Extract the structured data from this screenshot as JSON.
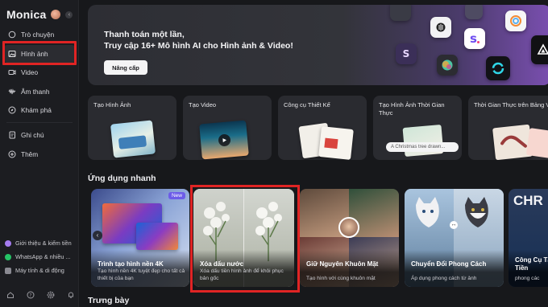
{
  "app": {
    "name": "Monica"
  },
  "sidebar": {
    "items": [
      {
        "label": "Trò chuyện",
        "icon": "chat-icon"
      },
      {
        "label": "Hình ảnh",
        "icon": "image-icon",
        "active": true
      },
      {
        "label": "Video",
        "icon": "video-icon"
      },
      {
        "label": "Âm thanh",
        "icon": "audio-icon"
      },
      {
        "label": "Khám phá",
        "icon": "compass-icon"
      }
    ],
    "items2": [
      {
        "label": "Ghi chú",
        "icon": "note-icon"
      },
      {
        "label": "Thêm",
        "icon": "plus-circle-icon"
      }
    ],
    "bottom": [
      {
        "label": "Giới thiệu & kiếm tiền",
        "color": "#a57cf0"
      },
      {
        "label": "WhatsApp & nhiều ...",
        "color": "#25c366"
      },
      {
        "label": "Máy tính & di động",
        "color": "#8a8a92"
      }
    ]
  },
  "hero": {
    "line1": "Thanh toán một lần,",
    "line2": "Truy cập 16+ Mô hình AI cho Hình ảnh & Video!",
    "button": "Nâng cấp"
  },
  "categories": [
    {
      "label": "Tạo Hình Ảnh"
    },
    {
      "label": "Tạo Video"
    },
    {
      "label": "Công cụ Thiết Kế"
    },
    {
      "label": "Tạo Hình Ảnh Thời Gian Thực",
      "input_placeholder": "A Christmas tree drawn..."
    },
    {
      "label": "Thời Gian Thực trên Bảng Vẽ"
    }
  ],
  "quick_apps_title": "Ứng dụng nhanh",
  "quick_apps": [
    {
      "name": "Trình tạo hình nền 4K",
      "desc": "Tạo hình nền 4K tuyệt đẹp cho tất cả thiết bị của bạn",
      "badge": "New"
    },
    {
      "name": "Xóa dấu nước",
      "desc": "Xóa dấu tiền hình ảnh để khôi phục bản gốc"
    },
    {
      "name": "Giữ Nguyên Khuôn Mặt",
      "desc": "Tạo hình với cùng khuôn mặt"
    },
    {
      "name": "Chuyển Đổi Phong Cách",
      "desc": "Áp dụng phong cách từ ảnh"
    },
    {
      "name": "Công Cụ Tạo Tiền",
      "desc": "phong các",
      "partial_art_text": "CHR"
    }
  ],
  "gallery_title": "Trưng bày",
  "colors": {
    "accent": "#6d5ce8",
    "highlight": "#e02424"
  }
}
